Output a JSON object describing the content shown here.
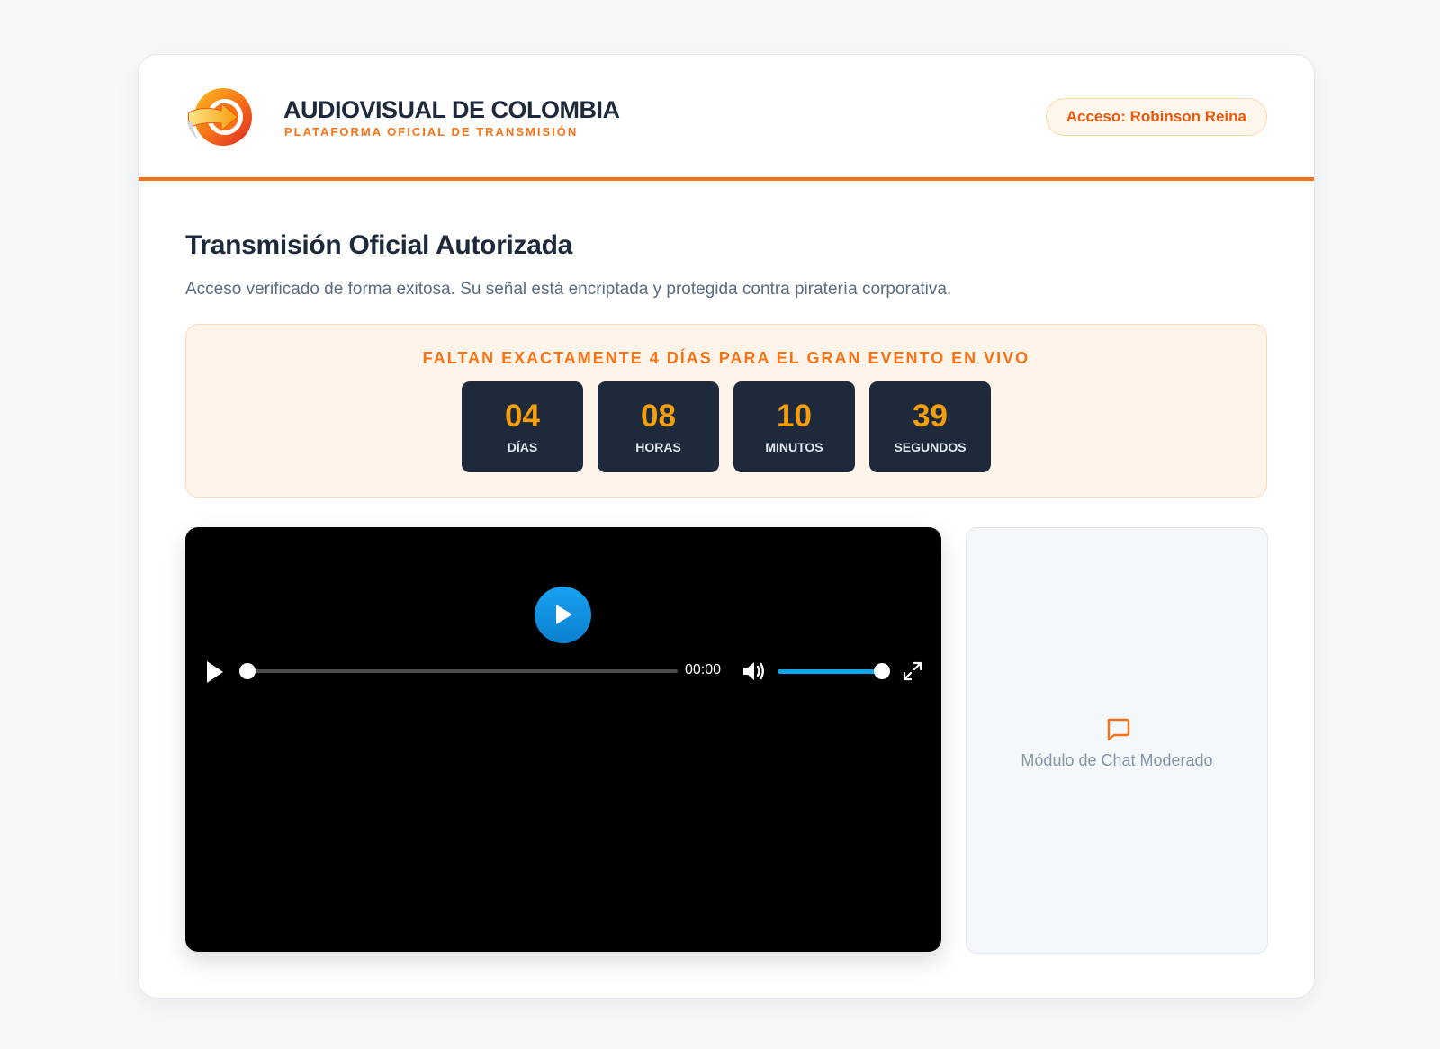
{
  "header": {
    "brand_title": "AUDIOVISUAL DE COLOMBIA",
    "brand_subtitle": "PLATAFORMA OFICIAL DE TRANSMISIÓN",
    "access_badge": "Acceso: Robinson Reina",
    "logo_icon": "arrow-circle-logo"
  },
  "main": {
    "title": "Transmisión Oficial Autorizada",
    "description": "Acceso verificado de forma exitosa. Su señal está encriptada y protegida contra piratería corporativa."
  },
  "countdown": {
    "title": "FALTAN EXACTAMENTE 4 DÍAS PARA EL GRAN EVENTO EN VIVO",
    "units": [
      {
        "value": "04",
        "label": "DÍAS"
      },
      {
        "value": "08",
        "label": "HORAS"
      },
      {
        "value": "10",
        "label": "MINUTOS"
      },
      {
        "value": "39",
        "label": "SEGUNDOS"
      }
    ]
  },
  "player": {
    "time": "00:00",
    "progress": 0,
    "volume": 1.0
  },
  "chat": {
    "label": "Módulo de Chat Moderado",
    "icon": "chat-bubble-icon"
  },
  "colors": {
    "accent": "#f97316",
    "dark": "#1e293b",
    "countdown_number": "#f59e0b",
    "player_blue": "#0ea5e9"
  }
}
